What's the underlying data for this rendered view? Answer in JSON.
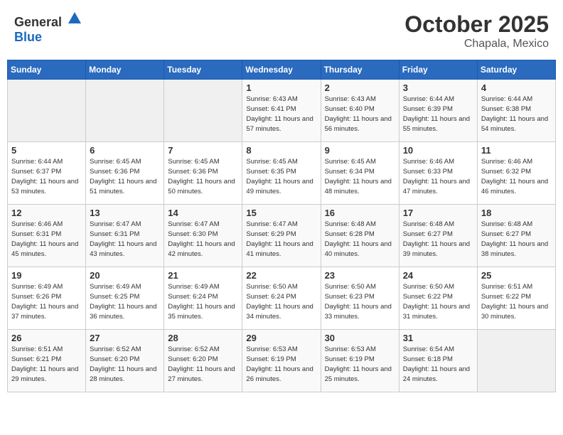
{
  "header": {
    "logo_general": "General",
    "logo_blue": "Blue",
    "month": "October 2025",
    "location": "Chapala, Mexico"
  },
  "weekdays": [
    "Sunday",
    "Monday",
    "Tuesday",
    "Wednesday",
    "Thursday",
    "Friday",
    "Saturday"
  ],
  "weeks": [
    [
      {
        "day": "",
        "empty": true
      },
      {
        "day": "",
        "empty": true
      },
      {
        "day": "",
        "empty": true
      },
      {
        "day": "1",
        "sunrise": "Sunrise: 6:43 AM",
        "sunset": "Sunset: 6:41 PM",
        "daylight": "Daylight: 11 hours and 57 minutes."
      },
      {
        "day": "2",
        "sunrise": "Sunrise: 6:43 AM",
        "sunset": "Sunset: 6:40 PM",
        "daylight": "Daylight: 11 hours and 56 minutes."
      },
      {
        "day": "3",
        "sunrise": "Sunrise: 6:44 AM",
        "sunset": "Sunset: 6:39 PM",
        "daylight": "Daylight: 11 hours and 55 minutes."
      },
      {
        "day": "4",
        "sunrise": "Sunrise: 6:44 AM",
        "sunset": "Sunset: 6:38 PM",
        "daylight": "Daylight: 11 hours and 54 minutes."
      }
    ],
    [
      {
        "day": "5",
        "sunrise": "Sunrise: 6:44 AM",
        "sunset": "Sunset: 6:37 PM",
        "daylight": "Daylight: 11 hours and 53 minutes."
      },
      {
        "day": "6",
        "sunrise": "Sunrise: 6:45 AM",
        "sunset": "Sunset: 6:36 PM",
        "daylight": "Daylight: 11 hours and 51 minutes."
      },
      {
        "day": "7",
        "sunrise": "Sunrise: 6:45 AM",
        "sunset": "Sunset: 6:36 PM",
        "daylight": "Daylight: 11 hours and 50 minutes."
      },
      {
        "day": "8",
        "sunrise": "Sunrise: 6:45 AM",
        "sunset": "Sunset: 6:35 PM",
        "daylight": "Daylight: 11 hours and 49 minutes."
      },
      {
        "day": "9",
        "sunrise": "Sunrise: 6:45 AM",
        "sunset": "Sunset: 6:34 PM",
        "daylight": "Daylight: 11 hours and 48 minutes."
      },
      {
        "day": "10",
        "sunrise": "Sunrise: 6:46 AM",
        "sunset": "Sunset: 6:33 PM",
        "daylight": "Daylight: 11 hours and 47 minutes."
      },
      {
        "day": "11",
        "sunrise": "Sunrise: 6:46 AM",
        "sunset": "Sunset: 6:32 PM",
        "daylight": "Daylight: 11 hours and 46 minutes."
      }
    ],
    [
      {
        "day": "12",
        "sunrise": "Sunrise: 6:46 AM",
        "sunset": "Sunset: 6:31 PM",
        "daylight": "Daylight: 11 hours and 45 minutes."
      },
      {
        "day": "13",
        "sunrise": "Sunrise: 6:47 AM",
        "sunset": "Sunset: 6:31 PM",
        "daylight": "Daylight: 11 hours and 43 minutes."
      },
      {
        "day": "14",
        "sunrise": "Sunrise: 6:47 AM",
        "sunset": "Sunset: 6:30 PM",
        "daylight": "Daylight: 11 hours and 42 minutes."
      },
      {
        "day": "15",
        "sunrise": "Sunrise: 6:47 AM",
        "sunset": "Sunset: 6:29 PM",
        "daylight": "Daylight: 11 hours and 41 minutes."
      },
      {
        "day": "16",
        "sunrise": "Sunrise: 6:48 AM",
        "sunset": "Sunset: 6:28 PM",
        "daylight": "Daylight: 11 hours and 40 minutes."
      },
      {
        "day": "17",
        "sunrise": "Sunrise: 6:48 AM",
        "sunset": "Sunset: 6:27 PM",
        "daylight": "Daylight: 11 hours and 39 minutes."
      },
      {
        "day": "18",
        "sunrise": "Sunrise: 6:48 AM",
        "sunset": "Sunset: 6:27 PM",
        "daylight": "Daylight: 11 hours and 38 minutes."
      }
    ],
    [
      {
        "day": "19",
        "sunrise": "Sunrise: 6:49 AM",
        "sunset": "Sunset: 6:26 PM",
        "daylight": "Daylight: 11 hours and 37 minutes."
      },
      {
        "day": "20",
        "sunrise": "Sunrise: 6:49 AM",
        "sunset": "Sunset: 6:25 PM",
        "daylight": "Daylight: 11 hours and 36 minutes."
      },
      {
        "day": "21",
        "sunrise": "Sunrise: 6:49 AM",
        "sunset": "Sunset: 6:24 PM",
        "daylight": "Daylight: 11 hours and 35 minutes."
      },
      {
        "day": "22",
        "sunrise": "Sunrise: 6:50 AM",
        "sunset": "Sunset: 6:24 PM",
        "daylight": "Daylight: 11 hours and 34 minutes."
      },
      {
        "day": "23",
        "sunrise": "Sunrise: 6:50 AM",
        "sunset": "Sunset: 6:23 PM",
        "daylight": "Daylight: 11 hours and 33 minutes."
      },
      {
        "day": "24",
        "sunrise": "Sunrise: 6:50 AM",
        "sunset": "Sunset: 6:22 PM",
        "daylight": "Daylight: 11 hours and 31 minutes."
      },
      {
        "day": "25",
        "sunrise": "Sunrise: 6:51 AM",
        "sunset": "Sunset: 6:22 PM",
        "daylight": "Daylight: 11 hours and 30 minutes."
      }
    ],
    [
      {
        "day": "26",
        "sunrise": "Sunrise: 6:51 AM",
        "sunset": "Sunset: 6:21 PM",
        "daylight": "Daylight: 11 hours and 29 minutes."
      },
      {
        "day": "27",
        "sunrise": "Sunrise: 6:52 AM",
        "sunset": "Sunset: 6:20 PM",
        "daylight": "Daylight: 11 hours and 28 minutes."
      },
      {
        "day": "28",
        "sunrise": "Sunrise: 6:52 AM",
        "sunset": "Sunset: 6:20 PM",
        "daylight": "Daylight: 11 hours and 27 minutes."
      },
      {
        "day": "29",
        "sunrise": "Sunrise: 6:53 AM",
        "sunset": "Sunset: 6:19 PM",
        "daylight": "Daylight: 11 hours and 26 minutes."
      },
      {
        "day": "30",
        "sunrise": "Sunrise: 6:53 AM",
        "sunset": "Sunset: 6:19 PM",
        "daylight": "Daylight: 11 hours and 25 minutes."
      },
      {
        "day": "31",
        "sunrise": "Sunrise: 6:54 AM",
        "sunset": "Sunset: 6:18 PM",
        "daylight": "Daylight: 11 hours and 24 minutes."
      },
      {
        "day": "",
        "empty": true
      }
    ]
  ]
}
